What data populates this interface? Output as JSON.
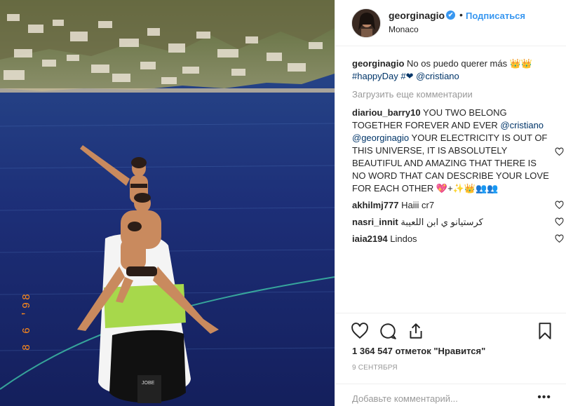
{
  "post": {
    "username": "georginagio",
    "verified_mark": "✔",
    "dot": "•",
    "follow_label": "Подписаться",
    "location": "Monaco",
    "photo_date_stamp": "8 6 '98",
    "board_brand": "JOBE"
  },
  "caption": {
    "username": "georginagio",
    "text": "No os puedo querer más 👑👑",
    "hashtag": "#happyDay",
    "hash_heart": "#❤",
    "mention": "@cristiano"
  },
  "load_more_label": "Загрузить еще комментарии",
  "comments": [
    {
      "username": "diariou_barry10",
      "text_a": "YOU TWO BELONG TOGETHER FOREVER AND EVER",
      "mention_1": "@cristiano",
      "mention_2": "@georginagio",
      "text_b": "YOUR ELECTRICITY IS OUT OF THIS UNIVERSE, IT IS ABSOLUTELY BEAUTIFUL AND AMAZING THAT THERE IS NO WORD THAT CAN DESCRIBE YOUR LOVE FOR EACH OTHER 💖+✨👑👥👥"
    },
    {
      "username": "akhilmj777",
      "text": "Haiii cr7"
    },
    {
      "username": "nasri_innit",
      "text": "كرستيانو ي ابن اللعيبة"
    },
    {
      "username": "iaia2194",
      "text": "Lindos"
    }
  ],
  "likes_text": "1 364 547 отметок \"Нравится\"",
  "date": "9 СЕНТЯБРЯ",
  "add_comment_placeholder": "Добавьте комментарий...",
  "more_options": "•••",
  "icons": {
    "like": "heart-icon",
    "comment": "comment-bubble-icon",
    "share": "share-icon",
    "save": "bookmark-icon"
  }
}
